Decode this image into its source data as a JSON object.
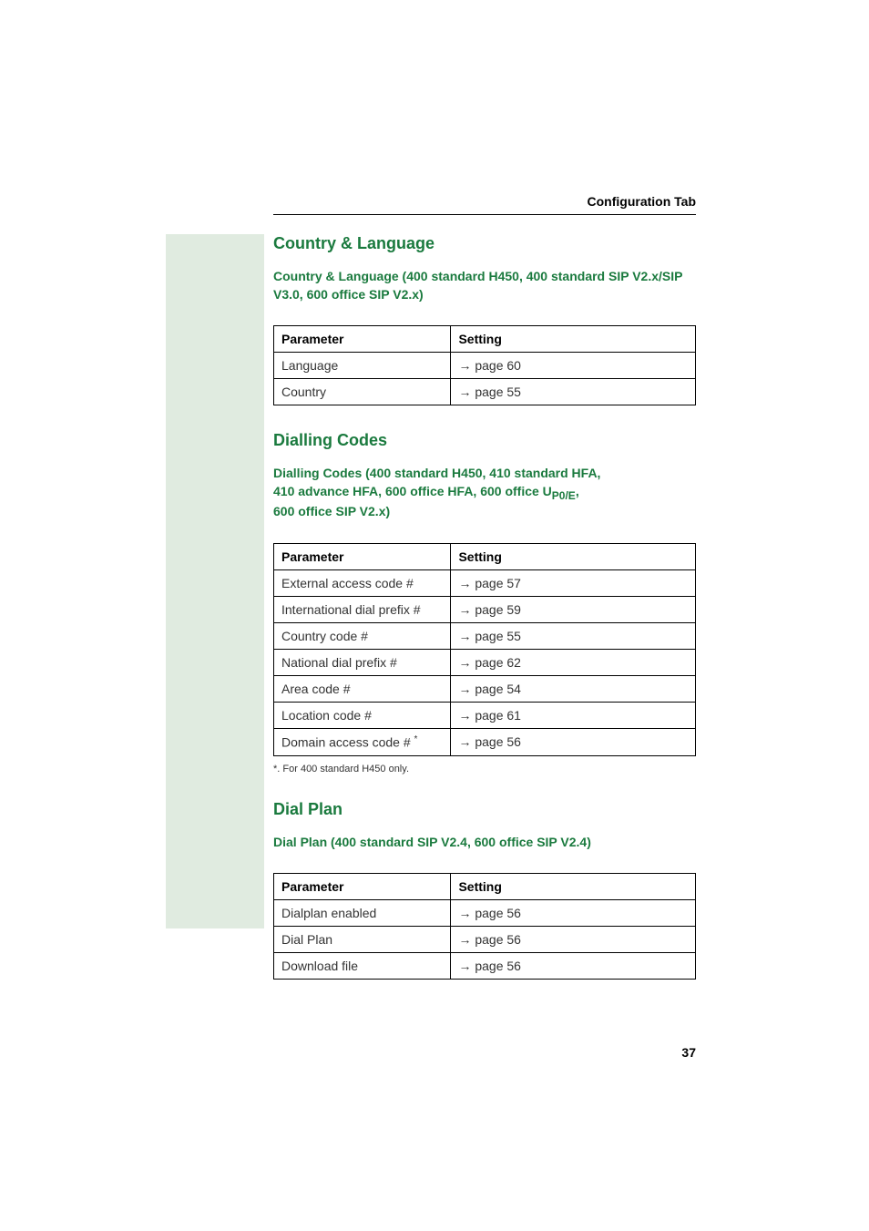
{
  "header": {
    "title": "Configuration Tab"
  },
  "sections": {
    "country_language": {
      "heading": "Country & Language",
      "subheading": "Country & Language (400 standard H450, 400 standard SIP V2.x/SIP V3.0, 600 office SIP V2.x)",
      "table": {
        "headers": [
          "Parameter",
          "Setting"
        ],
        "rows": [
          {
            "param": "Language",
            "setting_prefix": "→",
            "setting_text": "page 60"
          },
          {
            "param": "Country",
            "setting_prefix": "→",
            "setting_text": "page 55"
          }
        ]
      }
    },
    "dialling_codes": {
      "heading": "Dialling Codes",
      "subheading_line1": "Dialling Codes (400 standard H450, 410 standard HFA,",
      "subheading_line2_pre": "410 advance HFA, 600 office HFA, 600 office U",
      "subheading_line2_sub": "P0/E",
      "subheading_line2_post": ",",
      "subheading_line3": "600 office SIP V2.x)",
      "table": {
        "headers": [
          "Parameter",
          "Setting"
        ],
        "rows": [
          {
            "param": "External access code #",
            "setting_prefix": "→",
            "setting_text": "page 57",
            "has_asterisk": false
          },
          {
            "param": "International dial prefix #",
            "setting_prefix": "→",
            "setting_text": "page 59",
            "has_asterisk": false
          },
          {
            "param": "Country code #",
            "setting_prefix": "→",
            "setting_text": "page 55",
            "has_asterisk": false
          },
          {
            "param": "National dial prefix #",
            "setting_prefix": "→",
            "setting_text": "page 62",
            "has_asterisk": false
          },
          {
            "param": "Area code #",
            "setting_prefix": "→",
            "setting_text": "page 54",
            "has_asterisk": false
          },
          {
            "param": "Location code #",
            "setting_prefix": "→",
            "setting_text": "page 61",
            "has_asterisk": false
          },
          {
            "param": "Domain access code #",
            "setting_prefix": "→",
            "setting_text": "page 56",
            "has_asterisk": true,
            "asterisk": "*"
          }
        ]
      },
      "footnote": "*.   For 400 standard H450 only."
    },
    "dial_plan": {
      "heading": "Dial Plan",
      "subheading": "Dial Plan (400 standard SIP V2.4, 600 office SIP V2.4)",
      "table": {
        "headers": [
          "Parameter",
          "Setting"
        ],
        "rows": [
          {
            "param": "Dialplan enabled",
            "setting_prefix": "→",
            "setting_text": "page 56"
          },
          {
            "param": "Dial Plan",
            "setting_prefix": "→",
            "setting_text": "page 56"
          },
          {
            "param": "Download file",
            "setting_prefix": "→",
            "setting_text": "page 56"
          }
        ]
      }
    }
  },
  "page_number": "37"
}
